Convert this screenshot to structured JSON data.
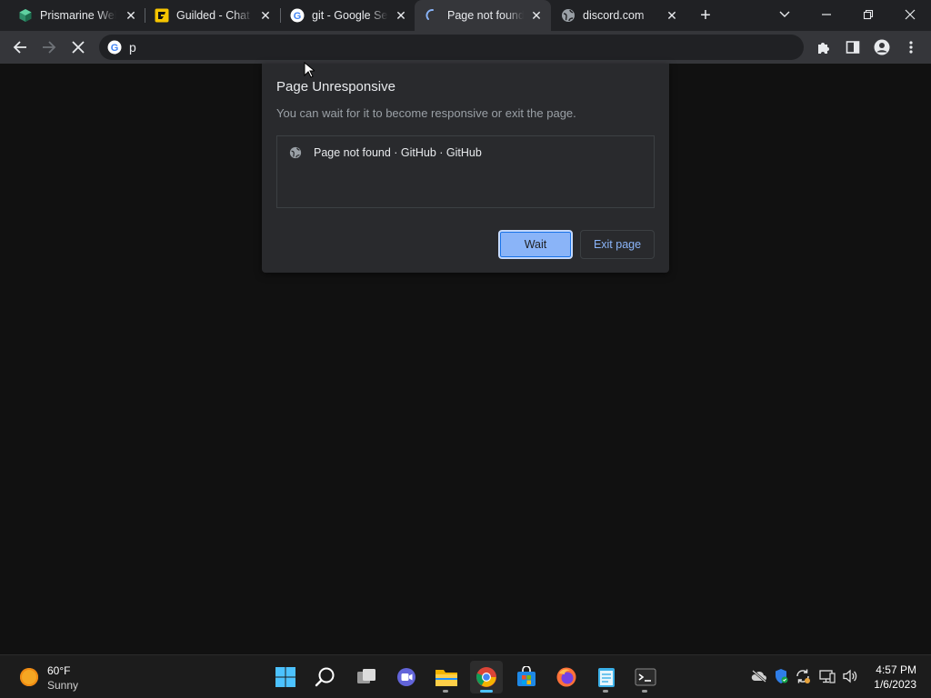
{
  "browser": {
    "tabs": [
      {
        "title": "Prismarine Web",
        "favicon": "prismarine-cube-icon"
      },
      {
        "title": "Guilded - Chat f",
        "favicon": "guilded-icon"
      },
      {
        "title": "git - Google Sea",
        "favicon": "google-icon"
      },
      {
        "title": "Page not found",
        "favicon": "loading-spinner-icon",
        "active": true
      },
      {
        "title": "discord.com",
        "favicon": "globe-icon"
      }
    ],
    "omnibox": {
      "text": "p"
    }
  },
  "dialog": {
    "title": "Page Unresponsive",
    "body": "You can wait for it to become responsive or exit the page.",
    "page_item": "Page not found · GitHub · GitHub",
    "wait_label": "Wait",
    "exit_label": "Exit page"
  },
  "taskbar": {
    "weather": {
      "temp": "60°F",
      "condition": "Sunny"
    },
    "clock": {
      "time": "4:57 PM",
      "date": "1/6/2023"
    }
  },
  "colors": {
    "accent": "#8ab4f8",
    "tab_strip": "#202124",
    "toolbar": "#35363a",
    "dialog": "#292a2d"
  }
}
